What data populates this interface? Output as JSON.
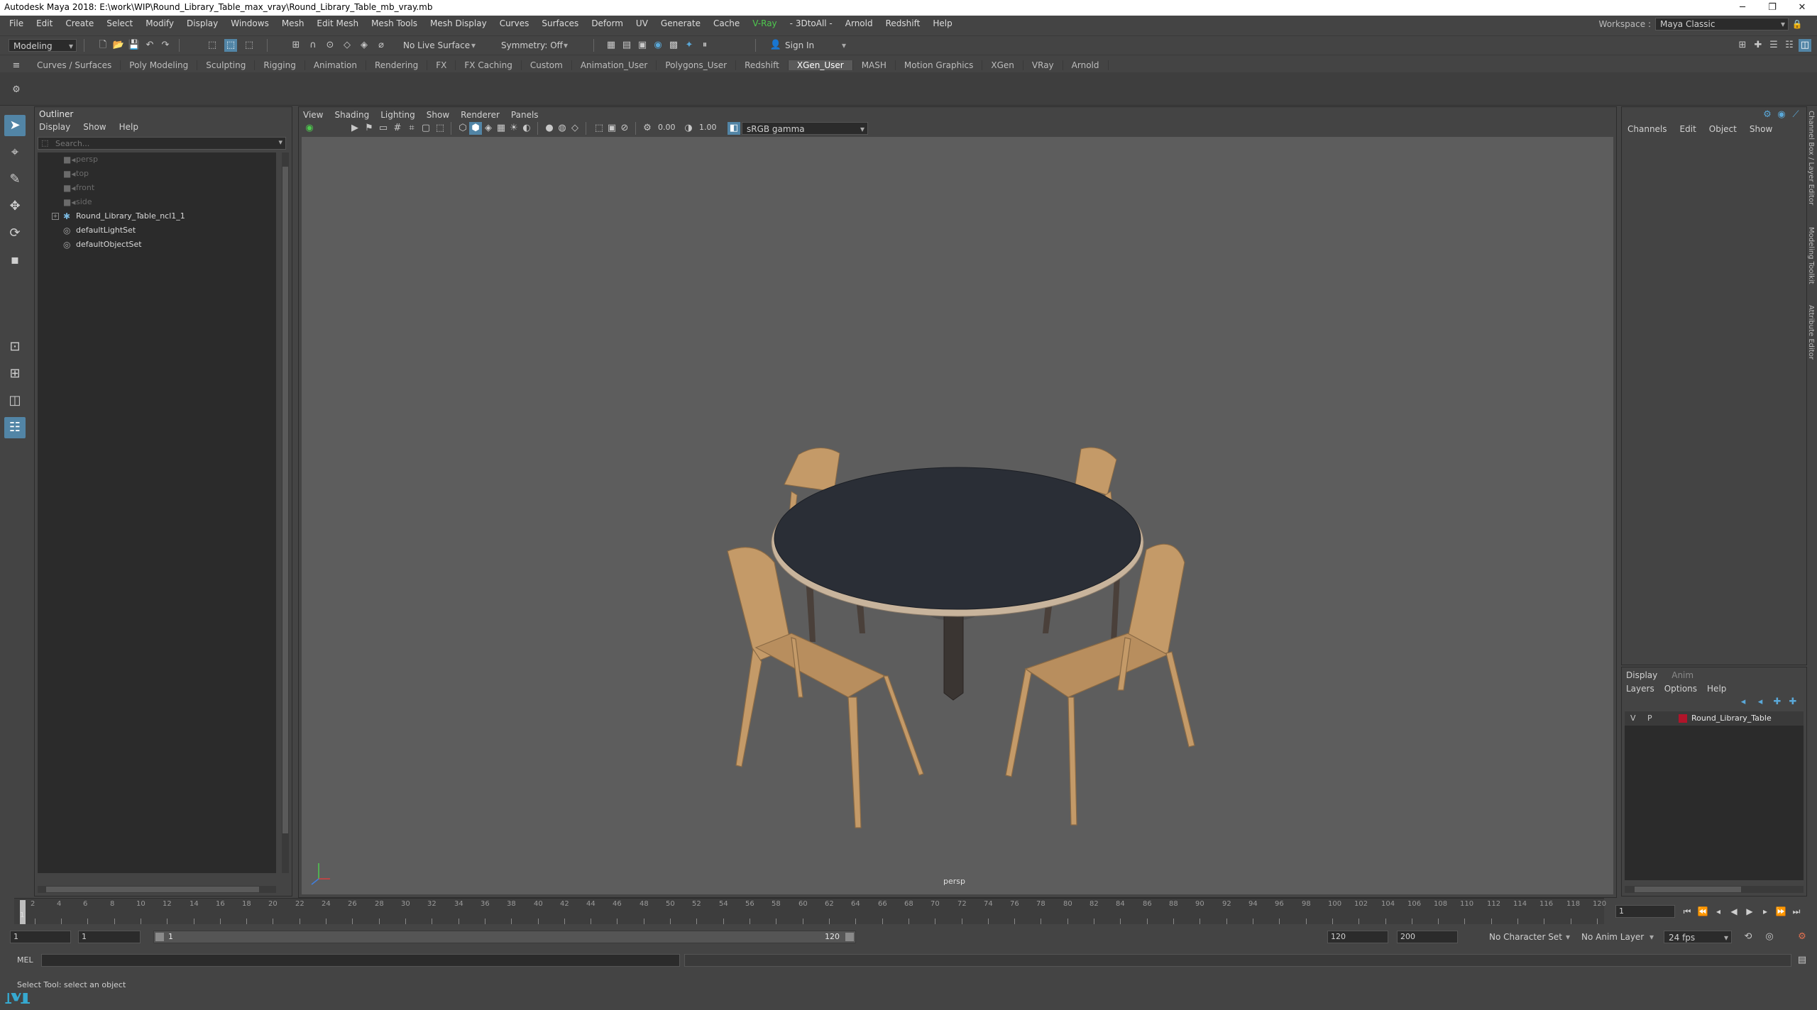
{
  "window": {
    "title": "Autodesk Maya 2018: E:\\work\\WIP\\Round_Library_Table_max_vray\\Round_Library_Table_mb_vray.mb",
    "controls": [
      "─",
      "❐",
      "✕"
    ]
  },
  "menubar": {
    "items": [
      "File",
      "Edit",
      "Create",
      "Select",
      "Modify",
      "Display",
      "Windows",
      "Mesh",
      "Edit Mesh",
      "Mesh Tools",
      "Mesh Display",
      "Curves",
      "Surfaces",
      "Deform",
      "UV",
      "Generate",
      "Cache",
      "V-Ray",
      "- 3DtoAll -",
      "Arnold",
      "Redshift",
      "Help"
    ],
    "workspace_label": "Workspace :",
    "workspace_value": "Maya Classic"
  },
  "statusline": {
    "mode": "Modeling",
    "live_surface": "No Live Surface",
    "symmetry": "Symmetry: Off",
    "sign_in": "Sign In"
  },
  "shelf": {
    "tabs": [
      "Curves / Surfaces",
      "Poly Modeling",
      "Sculpting",
      "Rigging",
      "Animation",
      "Rendering",
      "FX",
      "FX Caching",
      "Custom",
      "Animation_User",
      "Polygons_User",
      "Redshift",
      "XGen_User",
      "MASH",
      "Motion Graphics",
      "XGen",
      "VRay",
      "Arnold"
    ],
    "active_tab": "XGen_User"
  },
  "outliner": {
    "title": "Outliner",
    "menu": [
      "Display",
      "Show",
      "Help"
    ],
    "search_placeholder": "Search...",
    "items": [
      {
        "label": "persp",
        "icon": "camera-icon",
        "dim": true
      },
      {
        "label": "top",
        "icon": "camera-icon",
        "dim": true
      },
      {
        "label": "front",
        "icon": "camera-icon",
        "dim": true
      },
      {
        "label": "side",
        "icon": "camera-icon",
        "dim": true
      },
      {
        "label": "Round_Library_Table_ncl1_1",
        "icon": "transform-icon",
        "dim": false,
        "expandable": true
      },
      {
        "label": "defaultLightSet",
        "icon": "set-icon",
        "dim": false
      },
      {
        "label": "defaultObjectSet",
        "icon": "set-icon",
        "dim": false
      }
    ]
  },
  "viewport": {
    "menu": [
      "View",
      "Shading",
      "Lighting",
      "Show",
      "Renderer",
      "Panels"
    ],
    "exposure": "0.00",
    "gamma": "1.00",
    "color_space": "sRGB gamma",
    "camera": "persp"
  },
  "channelbox": {
    "menu": [
      "Channels",
      "Edit",
      "Object",
      "Show"
    ]
  },
  "layers": {
    "tabs": [
      "Display",
      "Anim"
    ],
    "menu": [
      "Layers",
      "Options",
      "Help"
    ],
    "rows": [
      {
        "v": "V",
        "p": "P",
        "name": "Round_Library_Table",
        "color": "#b0142a"
      }
    ]
  },
  "side_tabs": [
    "Channel Box / Layer Editor",
    "Modeling Toolkit",
    "Attribute Editor"
  ],
  "timeslider": {
    "ticks": [
      2,
      4,
      6,
      8,
      10,
      12,
      14,
      16,
      18,
      20,
      22,
      24,
      26,
      28,
      30,
      32,
      34,
      36,
      38,
      40,
      42,
      44,
      46,
      48,
      50,
      52,
      54,
      56,
      58,
      60,
      62,
      64,
      66,
      68,
      70,
      72,
      74,
      76,
      78,
      80,
      82,
      84,
      86,
      88,
      90,
      92,
      94,
      96,
      98,
      100,
      102,
      104,
      106,
      108,
      110,
      112,
      114,
      116,
      118,
      120
    ],
    "current_frame_label": "1",
    "current_frame": "1"
  },
  "rangeslider": {
    "start": "1",
    "inner_start": "1",
    "range_start_label": "1",
    "range_end_label": "120",
    "end": "120",
    "anim_end": "200",
    "character_set": "No Character Set",
    "anim_layer": "No Anim Layer",
    "fps": "24 fps"
  },
  "cmdline": {
    "label": "MEL"
  },
  "helpline": {
    "text": "Select Tool: select an object"
  },
  "colors": {
    "accent": "#5285a6",
    "vray": "#4ec94e",
    "viewport_bg": "#5d5d5d",
    "tabletop": "#2a2e36",
    "wood": "#c49a68"
  }
}
